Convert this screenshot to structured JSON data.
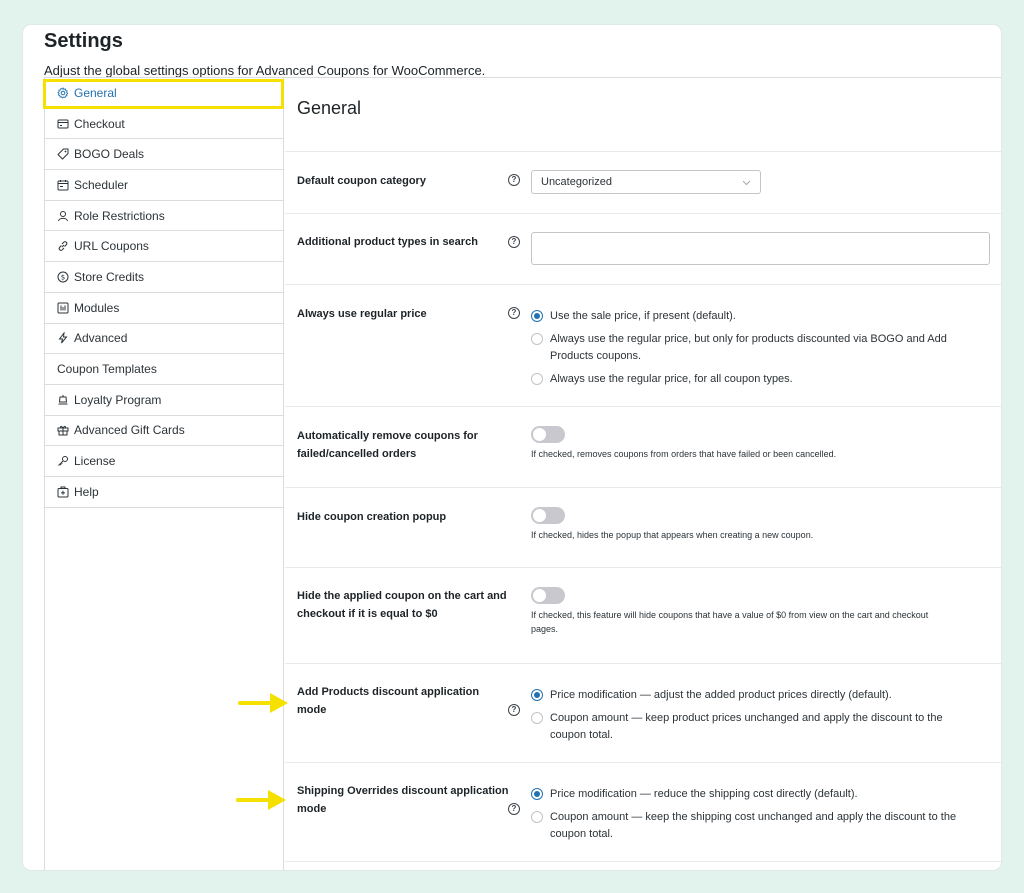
{
  "header": {
    "title": "Settings",
    "description": "Adjust the global settings options for Advanced Coupons for WooCommerce."
  },
  "sidebar": {
    "items": [
      {
        "label": "General",
        "icon": "gear-icon",
        "active": true
      },
      {
        "label": "Checkout",
        "icon": "checkout-icon"
      },
      {
        "label": "BOGO Deals",
        "icon": "tag-icon"
      },
      {
        "label": "Scheduler",
        "icon": "calendar-icon"
      },
      {
        "label": "Role Restrictions",
        "icon": "user-icon"
      },
      {
        "label": "URL Coupons",
        "icon": "link-icon"
      },
      {
        "label": "Store Credits",
        "icon": "dollar-icon"
      },
      {
        "label": "Modules",
        "icon": "modules-icon"
      },
      {
        "label": "Advanced",
        "icon": "lightning-icon"
      },
      {
        "label": "Coupon Templates",
        "icon": ""
      },
      {
        "label": "Loyalty Program",
        "icon": "loyalty-icon"
      },
      {
        "label": "Advanced Gift Cards",
        "icon": "gift-icon"
      },
      {
        "label": "License",
        "icon": "key-icon"
      },
      {
        "label": "Help",
        "icon": "help-box-icon"
      }
    ]
  },
  "main": {
    "title": "General",
    "default_category": {
      "label": "Default coupon category",
      "value": "Uncategorized"
    },
    "additional_types": {
      "label": "Additional product types in search",
      "value": ""
    },
    "regular_price": {
      "label": "Always use regular price",
      "options": [
        {
          "label": "Use the sale price, if present (default).",
          "checked": true
        },
        {
          "label": "Always use the regular price, but only for products discounted via BOGO and Add Products coupons.",
          "checked": false
        },
        {
          "label": "Always use the regular price, for all coupon types.",
          "checked": false
        }
      ]
    },
    "auto_remove": {
      "label": "Automatically remove coupons for failed/cancelled orders",
      "description": "If checked, removes coupons from orders that have failed or been cancelled.",
      "enabled": false
    },
    "hide_popup": {
      "label": "Hide coupon creation popup",
      "description": "If checked, hides the popup that appears when creating a new coupon.",
      "enabled": false
    },
    "hide_zero": {
      "label": "Hide the applied coupon on the cart and checkout if it is equal to $0",
      "description": "If checked, this feature will hide coupons that have a value of $0 from view on the cart and checkout pages.",
      "enabled": false
    },
    "add_products_mode": {
      "label": "Add Products discount application mode",
      "options": [
        {
          "label": "Price modification — adjust the added product prices directly (default).",
          "checked": true
        },
        {
          "label": "Coupon amount — keep product prices unchanged and apply the discount to the coupon total.",
          "checked": false
        }
      ]
    },
    "shipping_mode": {
      "label": "Shipping Overrides discount application mode",
      "options": [
        {
          "label": "Price modification — reduce the shipping cost directly (default).",
          "checked": true
        },
        {
          "label": "Coupon amount — keep the shipping cost unchanged and apply the discount to the coupon total.",
          "checked": false
        }
      ]
    },
    "help_glyph": "?"
  },
  "colors": {
    "background": "#e2f2ec",
    "accent": "#2271b1",
    "highlight": "#f5e000"
  }
}
